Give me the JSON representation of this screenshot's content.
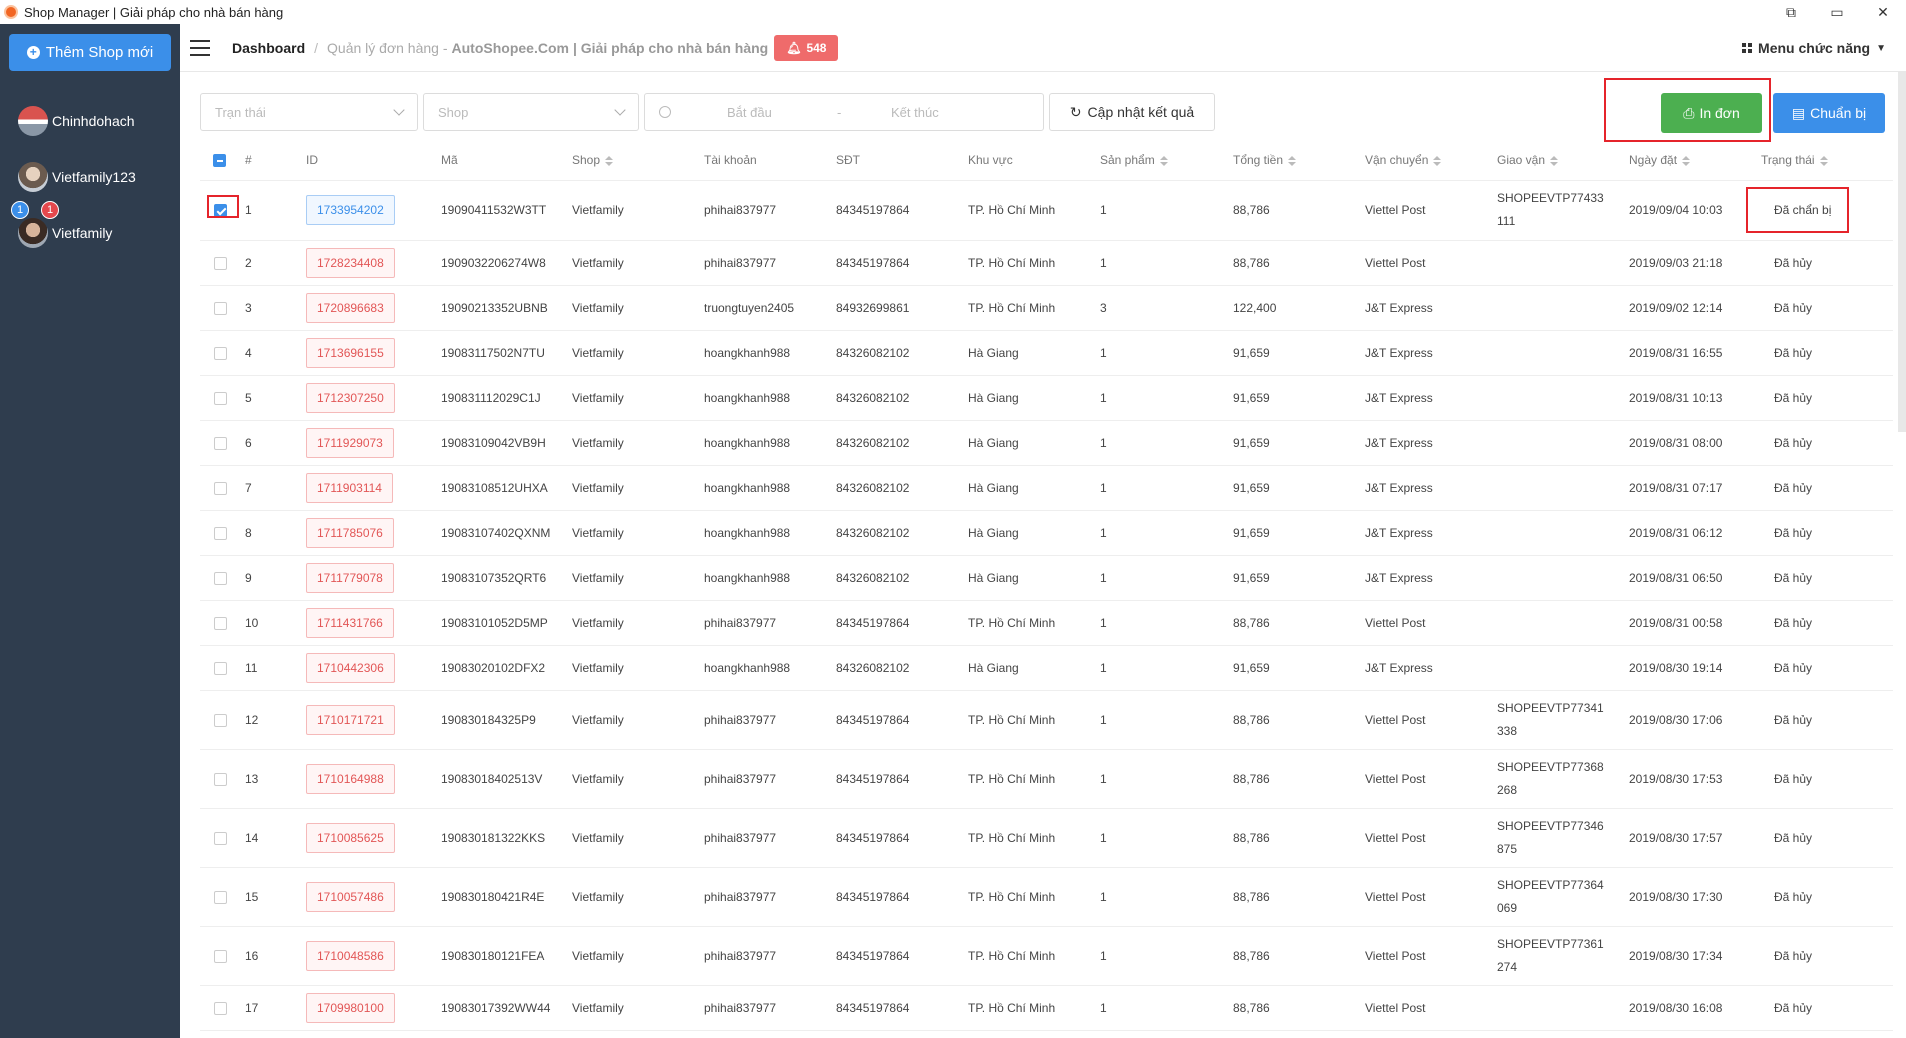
{
  "window": {
    "title": "Shop Manager | Giải pháp cho nhà bán hàng",
    "controls": [
      "⧉",
      "▭",
      "✕"
    ]
  },
  "sidebar": {
    "add_shop_label": "Thêm Shop mới",
    "shops": [
      {
        "name": "Chinhdohach",
        "badges": []
      },
      {
        "name": "Vietfamily123",
        "badges": []
      },
      {
        "name": "Vietfamily",
        "badges": [
          {
            "value": "1",
            "color": "#3b8fe9"
          },
          {
            "value": "1",
            "color": "#e5484d"
          }
        ]
      }
    ]
  },
  "header": {
    "breadcrumb_root": "Dashboard",
    "separator": "/",
    "page": "Quản lý đơn hàng -",
    "brand": "AutoShopee.Com",
    "tagline": "| Giải pháp cho nhà bán hàng",
    "notification_count": "548",
    "menu_label": "Menu chức năng"
  },
  "filters": {
    "status_placeholder": "Trạn thái",
    "shop_placeholder": "Shop",
    "start_placeholder": "Bắt đầu",
    "range_sep": "-",
    "end_placeholder": "Kết thúc",
    "refresh_label": "Cập nhật kết quả"
  },
  "actions": {
    "print_label": "In đơn",
    "prepare_label": "Chuẩn bị"
  },
  "table": {
    "columns": [
      "#",
      "ID",
      "Mã",
      "Shop",
      "Tài khoản",
      "SĐT",
      "Khu vực",
      "Sản phẩm",
      "Tổng tiền",
      "Vận chuyển",
      "Giao vận",
      "Ngày đặt",
      "Trạng thái"
    ],
    "rows": [
      {
        "num": "1",
        "id": "1733954202",
        "code": "19090411532W3TT",
        "shop": "Vietfamily",
        "account": "phihai837977",
        "phone": "84345197864",
        "region": "TP. Hồ Chí Minh",
        "products": "1",
        "total": "88,786",
        "carrier": "Viettel Post",
        "tracking": [
          "SHOPEEVTP77433",
          "111"
        ],
        "date": "2019/09/04 10:03",
        "status": "Đã chẩn bị",
        "checked": true
      },
      {
        "num": "2",
        "id": "1728234408",
        "code": "1909032206274W8",
        "shop": "Vietfamily",
        "account": "phihai837977",
        "phone": "84345197864",
        "region": "TP. Hồ Chí Minh",
        "products": "1",
        "total": "88,786",
        "carrier": "Viettel Post",
        "tracking": [],
        "date": "2019/09/03 21:18",
        "status": "Đã hủy",
        "checked": false
      },
      {
        "num": "3",
        "id": "1720896683",
        "code": "19090213352UBNB",
        "shop": "Vietfamily",
        "account": "truongtuyen2405",
        "phone": "84932699861",
        "region": "TP. Hồ Chí Minh",
        "products": "3",
        "total": "122,400",
        "carrier": "J&T Express",
        "tracking": [],
        "date": "2019/09/02 12:14",
        "status": "Đã hủy",
        "checked": false
      },
      {
        "num": "4",
        "id": "1713696155",
        "code": "19083117502N7TU",
        "shop": "Vietfamily",
        "account": "hoangkhanh988",
        "phone": "84326082102",
        "region": "Hà Giang",
        "products": "1",
        "total": "91,659",
        "carrier": "J&T Express",
        "tracking": [],
        "date": "2019/08/31 16:55",
        "status": "Đã hủy",
        "checked": false
      },
      {
        "num": "5",
        "id": "1712307250",
        "code": "190831112029C1J",
        "shop": "Vietfamily",
        "account": "hoangkhanh988",
        "phone": "84326082102",
        "region": "Hà Giang",
        "products": "1",
        "total": "91,659",
        "carrier": "J&T Express",
        "tracking": [],
        "date": "2019/08/31 10:13",
        "status": "Đã hủy",
        "checked": false
      },
      {
        "num": "6",
        "id": "1711929073",
        "code": "19083109042VB9H",
        "shop": "Vietfamily",
        "account": "hoangkhanh988",
        "phone": "84326082102",
        "region": "Hà Giang",
        "products": "1",
        "total": "91,659",
        "carrier": "J&T Express",
        "tracking": [],
        "date": "2019/08/31 08:00",
        "status": "Đã hủy",
        "checked": false
      },
      {
        "num": "7",
        "id": "1711903114",
        "code": "19083108512UHXA",
        "shop": "Vietfamily",
        "account": "hoangkhanh988",
        "phone": "84326082102",
        "region": "Hà Giang",
        "products": "1",
        "total": "91,659",
        "carrier": "J&T Express",
        "tracking": [],
        "date": "2019/08/31 07:17",
        "status": "Đã hủy",
        "checked": false
      },
      {
        "num": "8",
        "id": "1711785076",
        "code": "19083107402QXNM",
        "shop": "Vietfamily",
        "account": "hoangkhanh988",
        "phone": "84326082102",
        "region": "Hà Giang",
        "products": "1",
        "total": "91,659",
        "carrier": "J&T Express",
        "tracking": [],
        "date": "2019/08/31 06:12",
        "status": "Đã hủy",
        "checked": false
      },
      {
        "num": "9",
        "id": "1711779078",
        "code": "19083107352QRT6",
        "shop": "Vietfamily",
        "account": "hoangkhanh988",
        "phone": "84326082102",
        "region": "Hà Giang",
        "products": "1",
        "total": "91,659",
        "carrier": "J&T Express",
        "tracking": [],
        "date": "2019/08/31 06:50",
        "status": "Đã hủy",
        "checked": false
      },
      {
        "num": "10",
        "id": "1711431766",
        "code": "19083101052D5MP",
        "shop": "Vietfamily",
        "account": "phihai837977",
        "phone": "84345197864",
        "region": "TP. Hồ Chí Minh",
        "products": "1",
        "total": "88,786",
        "carrier": "Viettel Post",
        "tracking": [],
        "date": "2019/08/31 00:58",
        "status": "Đã hủy",
        "checked": false
      },
      {
        "num": "11",
        "id": "1710442306",
        "code": "19083020102DFX2",
        "shop": "Vietfamily",
        "account": "hoangkhanh988",
        "phone": "84326082102",
        "region": "Hà Giang",
        "products": "1",
        "total": "91,659",
        "carrier": "J&T Express",
        "tracking": [],
        "date": "2019/08/30 19:14",
        "status": "Đã hủy",
        "checked": false
      },
      {
        "num": "12",
        "id": "1710171721",
        "code": "190830184325P9",
        "shop": "Vietfamily",
        "account": "phihai837977",
        "phone": "84345197864",
        "region": "TP. Hồ Chí Minh",
        "products": "1",
        "total": "88,786",
        "carrier": "Viettel Post",
        "tracking": [
          "SHOPEEVTP77341",
          "338"
        ],
        "date": "2019/08/30 17:06",
        "status": "Đã hủy",
        "checked": false
      },
      {
        "num": "13",
        "id": "1710164988",
        "code": "19083018402513V",
        "shop": "Vietfamily",
        "account": "phihai837977",
        "phone": "84345197864",
        "region": "TP. Hồ Chí Minh",
        "products": "1",
        "total": "88,786",
        "carrier": "Viettel Post",
        "tracking": [
          "SHOPEEVTP77368",
          "268"
        ],
        "date": "2019/08/30 17:53",
        "status": "Đã hủy",
        "checked": false
      },
      {
        "num": "14",
        "id": "1710085625",
        "code": "190830181322KKS",
        "shop": "Vietfamily",
        "account": "phihai837977",
        "phone": "84345197864",
        "region": "TP. Hồ Chí Minh",
        "products": "1",
        "total": "88,786",
        "carrier": "Viettel Post",
        "tracking": [
          "SHOPEEVTP77346",
          "875"
        ],
        "date": "2019/08/30 17:57",
        "status": "Đã hủy",
        "checked": false
      },
      {
        "num": "15",
        "id": "1710057486",
        "code": "190830180421R4E",
        "shop": "Vietfamily",
        "account": "phihai837977",
        "phone": "84345197864",
        "region": "TP. Hồ Chí Minh",
        "products": "1",
        "total": "88,786",
        "carrier": "Viettel Post",
        "tracking": [
          "SHOPEEVTP77364",
          "069"
        ],
        "date": "2019/08/30 17:30",
        "status": "Đã hủy",
        "checked": false
      },
      {
        "num": "16",
        "id": "1710048586",
        "code": "190830180121FEA",
        "shop": "Vietfamily",
        "account": "phihai837977",
        "phone": "84345197864",
        "region": "TP. Hồ Chí Minh",
        "products": "1",
        "total": "88,786",
        "carrier": "Viettel Post",
        "tracking": [
          "SHOPEEVTP77361",
          "274"
        ],
        "date": "2019/08/30 17:34",
        "status": "Đã hủy",
        "checked": false
      },
      {
        "num": "17",
        "id": "1709980100",
        "code": "19083017392WW44",
        "shop": "Vietfamily",
        "account": "phihai837977",
        "phone": "84345197864",
        "region": "TP. Hồ Chí Minh",
        "products": "1",
        "total": "88,786",
        "carrier": "Viettel Post",
        "tracking": [],
        "date": "2019/08/30 16:08",
        "status": "Đã hủy",
        "checked": false
      }
    ]
  }
}
